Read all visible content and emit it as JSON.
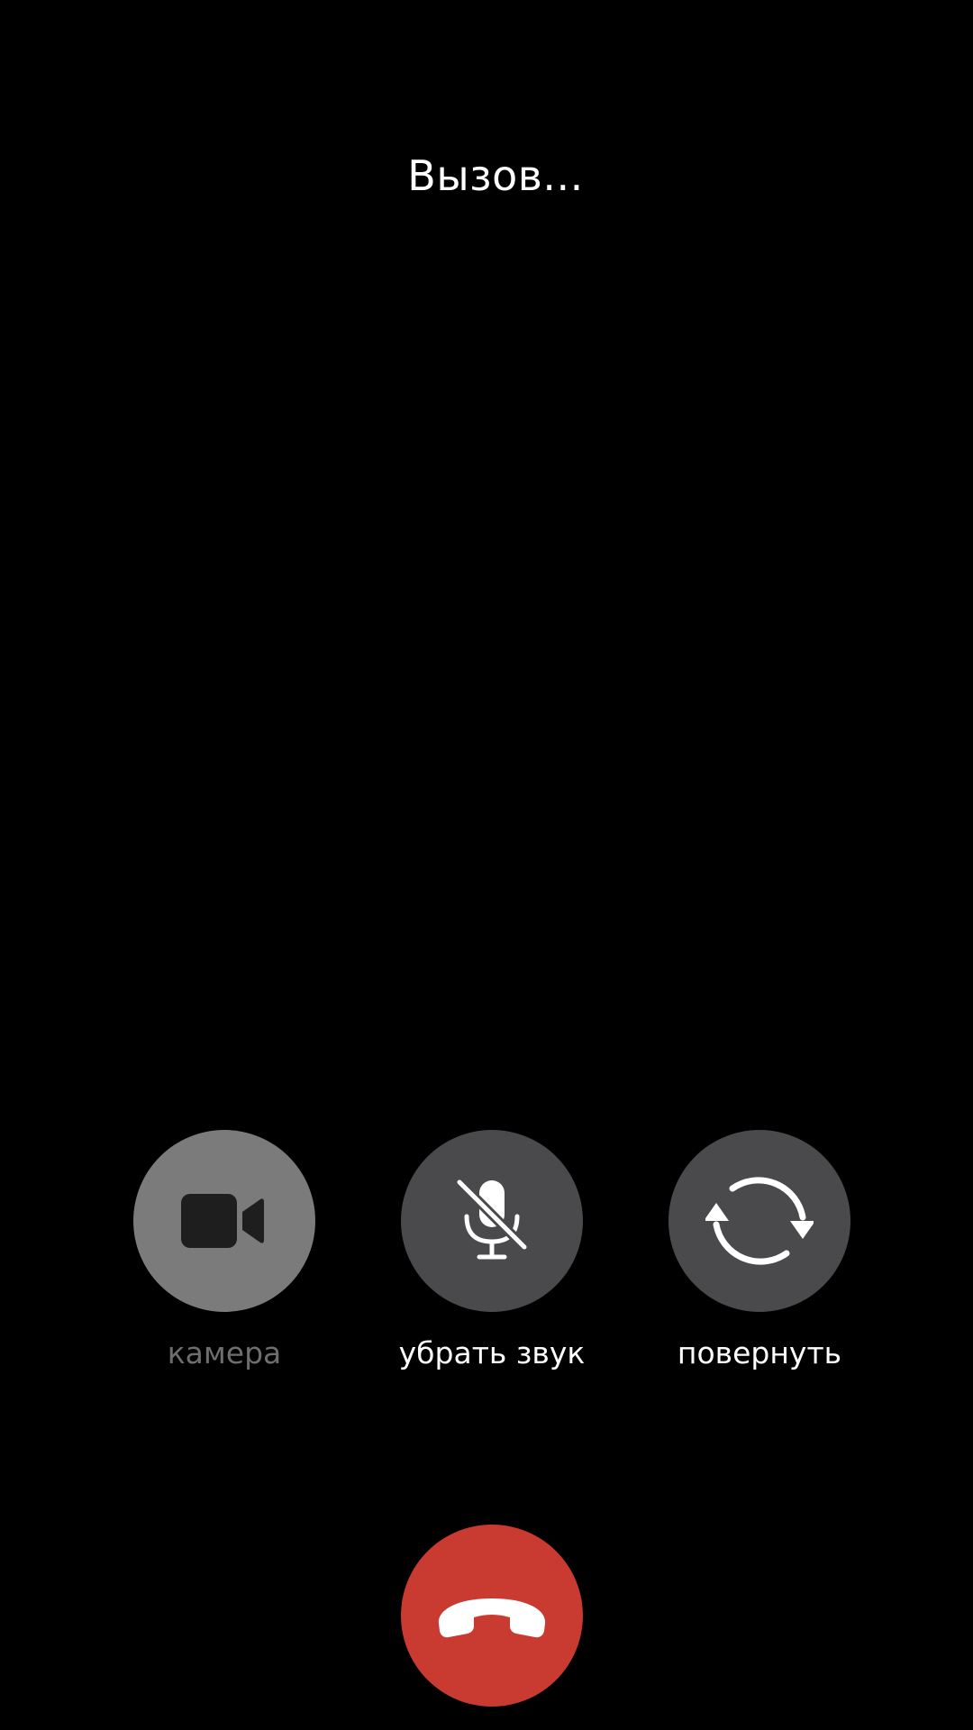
{
  "call": {
    "status_text": "Вызов..."
  },
  "controls": [
    {
      "id": "camera",
      "label": "камера",
      "icon": "video-camera-icon",
      "enabled": false
    },
    {
      "id": "mute",
      "label": "убрать звук",
      "icon": "microphone-slash-icon",
      "enabled": true
    },
    {
      "id": "flip",
      "label": "повернуть",
      "icon": "rotate-camera-icon",
      "enabled": true
    }
  ],
  "end_call": {
    "icon": "phone-hangup-icon"
  },
  "colors": {
    "background": "#000000",
    "text": "#ffffff",
    "label_disabled": "#6e6e6e",
    "camera_button_bg": "#7b7b7b",
    "control_button_bg": "#4a4a4c",
    "end_call_bg": "#c93a30",
    "icon_dark": "#1e1e1e",
    "icon_light": "#ffffff"
  }
}
